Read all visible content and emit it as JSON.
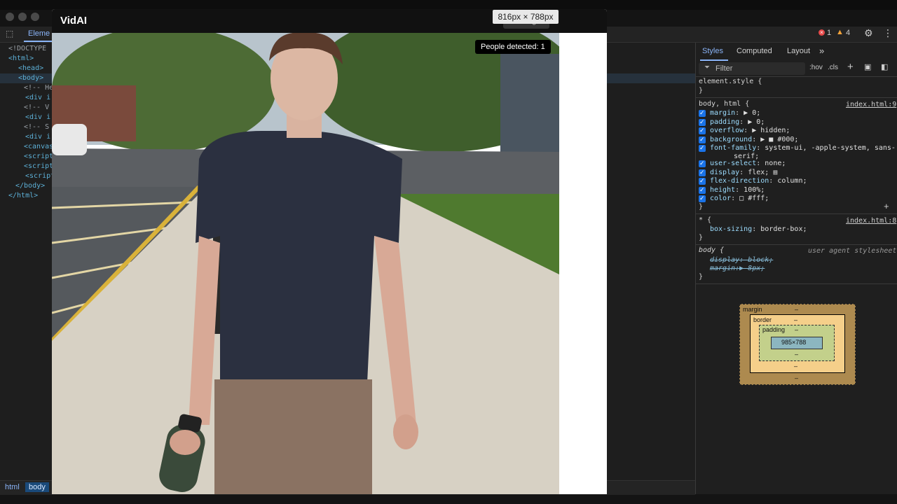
{
  "app": {
    "title": "VidAI",
    "settings_label": "Settings",
    "people_detected": "People detected: 1",
    "size_tooltip": "816px × 788px"
  },
  "devtools": {
    "elements_tab_partial": "Eleme",
    "error_count": "1",
    "warning_count": "4",
    "dom_lines": [
      "<!DOCTYPE",
      "<html>",
      "<head>",
      "<body>",
      "<!-- He",
      "<div i",
      "<!-- V",
      "<div i",
      "<!-- S",
      "<div i",
      "<canvas",
      "<script",
      "<script",
      "<script",
      "</body>",
      "</html>"
    ],
    "breadcrumb": {
      "html": "html",
      "body": "body"
    },
    "styles_tabs": {
      "styles": "Styles",
      "computed": "Computed",
      "layout": "Layout",
      "more": "»"
    },
    "filter_placeholder": "Filter",
    "hov": ":hov",
    "cls": ".cls",
    "rules": {
      "element_style": "element.style {",
      "body_html_selector": "body, html {",
      "body_html_source": "index.html:9",
      "props": [
        {
          "name": "margin",
          "value": "▶ 0;"
        },
        {
          "name": "padding",
          "value": "▶ 0;"
        },
        {
          "name": "overflow",
          "value": "▶ hidden;"
        },
        {
          "name": "background",
          "value": "▶ ■ #000;"
        },
        {
          "name": "font-family",
          "value": "system-ui, -apple-system, sans-"
        },
        {
          "name": "user-select",
          "value": "none;"
        },
        {
          "name": "display",
          "value": "flex;"
        },
        {
          "name": "flex-direction",
          "value": "column;"
        },
        {
          "name": "height",
          "value": "100%;"
        },
        {
          "name": "color",
          "value": "□ #fff;"
        }
      ],
      "font_family_cont": "serif;",
      "star_selector": "* {",
      "star_source": "index.html:8",
      "star_prop": "box-sizing",
      "star_value": "border-box;",
      "ua_selector": "body {",
      "ua_source": "user agent stylesheet",
      "ua_display": "display: block;",
      "ua_margin": "margin:▶ 8px;",
      "close_brace": "}"
    },
    "box_model": {
      "margin_label": "margin",
      "border_label": "border",
      "padding_label": "padding",
      "content_size": "985×788",
      "dash": "–"
    }
  },
  "colors": {
    "accent": "#8ab4f8",
    "error": "#e64a4a",
    "warning": "#f2a33a"
  }
}
